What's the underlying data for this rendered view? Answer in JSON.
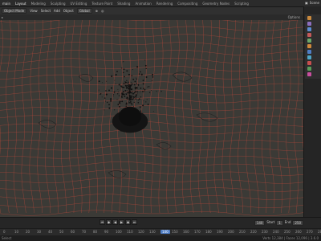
{
  "window": {
    "title": "main"
  },
  "workspaces": [
    "Layout",
    "Modeling",
    "Sculpting",
    "UV Editing",
    "Texture Paint",
    "Shading",
    "Animation",
    "Rendering",
    "Compositing",
    "Geometry Nodes",
    "Scripting"
  ],
  "active_workspace": "Layout",
  "scene": {
    "name": "Scene"
  },
  "toolbar": {
    "object_mode": "Object Mode",
    "view": "View",
    "select": "Select",
    "add": "Add",
    "object": "Object",
    "transform": "Global"
  },
  "header3": {
    "label": "Options"
  },
  "timeline": {
    "start_label": "Start",
    "start": "1",
    "end_label": "End",
    "end": "250",
    "current_frame": "140"
  },
  "ruler_ticks": [
    "0",
    "10",
    "20",
    "30",
    "40",
    "50",
    "60",
    "70",
    "80",
    "90",
    "100",
    "110",
    "120",
    "130",
    "140",
    "150",
    "160",
    "170",
    "180",
    "190",
    "200",
    "210",
    "220",
    "230",
    "240",
    "250",
    "260",
    "270",
    "280"
  ],
  "status": {
    "left": "Select",
    "right": "Verts 12,384 | Faces 12,096 | 3.6.0"
  },
  "colors": {
    "grid": "#b8473a",
    "grid_dark": "#7a332b",
    "viewport_bg": "#3b3a36",
    "accent": "#4f7ec6"
  }
}
